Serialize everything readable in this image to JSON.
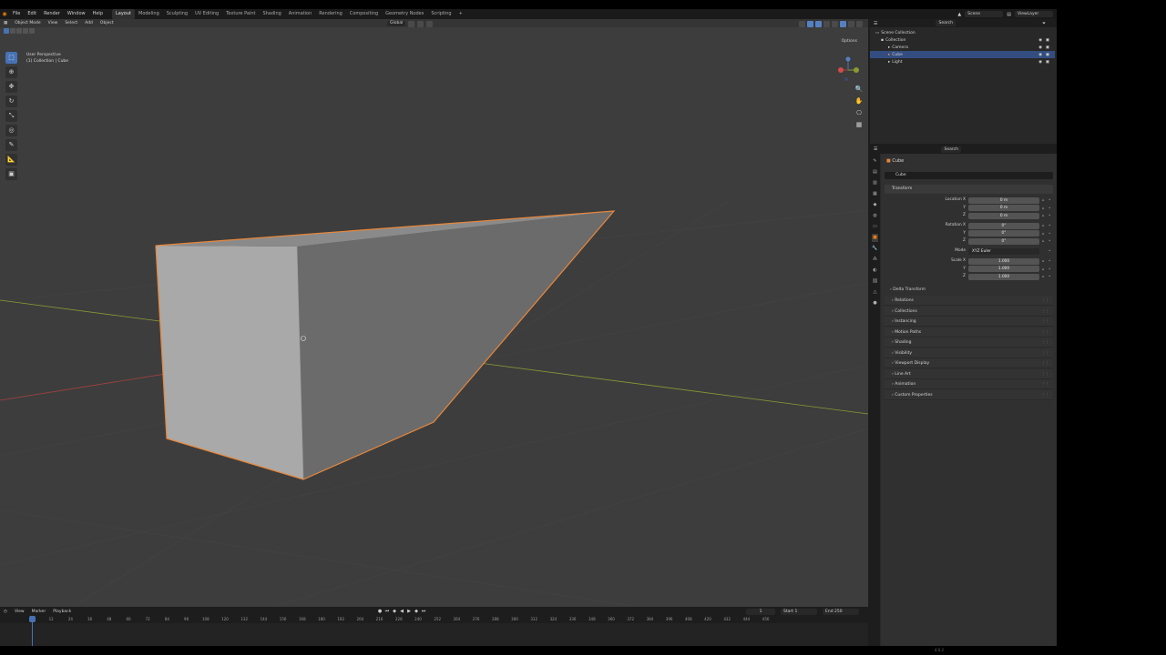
{
  "topbar": {
    "menus": [
      "File",
      "Edit",
      "Render",
      "Window",
      "Help"
    ],
    "workspaces": [
      "Layout",
      "Modeling",
      "Sculpting",
      "UV Editing",
      "Texture Paint",
      "Shading",
      "Animation",
      "Rendering",
      "Compositing",
      "Geometry Nodes",
      "Scripting"
    ],
    "active_workspace": "Layout",
    "add_tab": "+",
    "scene": "Scene",
    "view_layer": "ViewLayer"
  },
  "viewport": {
    "mode": "Object Mode",
    "menus": [
      "View",
      "Select",
      "Add",
      "Object"
    ],
    "orientation": "Global",
    "options": "Options",
    "overlay_line1": "User Perspective",
    "overlay_line2": "(1) Collection | Cube",
    "tools": [
      "select-box",
      "cursor",
      "move",
      "rotate",
      "scale",
      "transform",
      "annotate",
      "measure",
      "add-cube"
    ]
  },
  "timeline": {
    "menus": [
      "View",
      "Marker",
      "Playback"
    ],
    "current_frame": "1",
    "start_label": "Start",
    "start": "1",
    "end_label": "End",
    "end": "250",
    "ticks": [
      "0",
      "12",
      "24",
      "36",
      "48",
      "60",
      "72",
      "84",
      "96",
      "108",
      "120",
      "132",
      "144",
      "156",
      "168",
      "180",
      "192",
      "204",
      "216",
      "228",
      "240",
      "252",
      "264",
      "276",
      "288",
      "300",
      "312",
      "324",
      "336",
      "348",
      "360",
      "372",
      "384",
      "396",
      "408",
      "420",
      "432",
      "444",
      "456"
    ]
  },
  "outliner": {
    "search_placeholder": "Search",
    "rows": [
      {
        "label": "Scene Collection",
        "indent": 0,
        "selected": false
      },
      {
        "label": "Collection",
        "indent": 1,
        "selected": false
      },
      {
        "label": "Camera",
        "indent": 2,
        "selected": false
      },
      {
        "label": "Cube",
        "indent": 2,
        "selected": true
      },
      {
        "label": "Light",
        "indent": 2,
        "selected": false
      }
    ]
  },
  "properties": {
    "search_placeholder": "Search",
    "object_title": "Cube",
    "object_name": "Cube",
    "transform_label": "Transform",
    "location_label": "Location X",
    "location": [
      "0 m",
      "0 m",
      "0 m"
    ],
    "rotation_label": "Rotation X",
    "rotation": [
      "0°",
      "0°",
      "0°"
    ],
    "mode_label": "Mode",
    "mode": "XYZ Euler",
    "scale_label": "Scale X",
    "scale": [
      "1.000",
      "1.000",
      "1.000"
    ],
    "axis_y": "Y",
    "axis_z": "Z",
    "delta_transform": "Delta Transform",
    "collapsed_panels": [
      "Relations",
      "Collections",
      "Instancing",
      "Motion Paths",
      "Shading",
      "Visibility",
      "Viewport Display",
      "Line Art",
      "Animation",
      "Custom Properties"
    ]
  },
  "colors": {
    "selection_outline": "#e8873a",
    "accent_blue": "#4772b3",
    "x_axis": "#a8413f",
    "y_axis": "#8a9a34"
  },
  "version": "4.0.2"
}
